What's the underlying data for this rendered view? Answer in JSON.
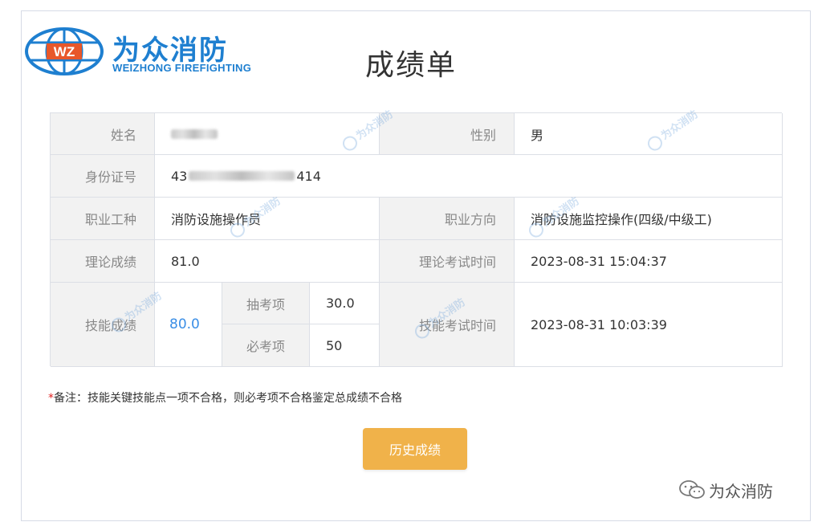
{
  "brand": {
    "logo_mark": "WZ",
    "name_cn": "为众消防",
    "name_en": "WEIZHONG FIREFIGHTING"
  },
  "page": {
    "title": "成绩单"
  },
  "report": {
    "name_label": "姓名",
    "gender_label": "性别",
    "gender_value": "男",
    "id_label": "身份证号",
    "id_prefix": "43",
    "id_suffix": "414",
    "occupation_label": "职业工种",
    "occupation_value": "消防设施操作员",
    "direction_label": "职业方向",
    "direction_value": "消防设施监控操作(四级/中级工)",
    "theory_score_label": "理论成绩",
    "theory_score_value": "81.0",
    "theory_time_label": "理论考试时间",
    "theory_time_value": "2023-08-31 15:04:37",
    "skill_score_label": "技能成绩",
    "skill_score_value": "80.0",
    "random_item_label": "抽考项",
    "random_item_value": "30.0",
    "required_item_label": "必考项",
    "required_item_value": "50",
    "skill_time_label": "技能考试时间",
    "skill_time_value": "2023-08-31 10:03:39"
  },
  "note": {
    "star": "*",
    "text": "备注：技能关键技能点一项不合格，则必考项不合格鉴定总成绩不合格"
  },
  "history_button": {
    "label": "历史成绩"
  },
  "footer": {
    "account_name": "为众消防"
  },
  "watermark": {
    "text": "为众消防"
  },
  "colors": {
    "accent_blue": "#1e7fd0",
    "skill_score_blue": "#3a8ee6",
    "button_orange": "#f0b24a",
    "required_star": "#e02020"
  },
  "icons": {
    "logo": "globe-wz-icon",
    "wechat": "wechat-icon"
  }
}
